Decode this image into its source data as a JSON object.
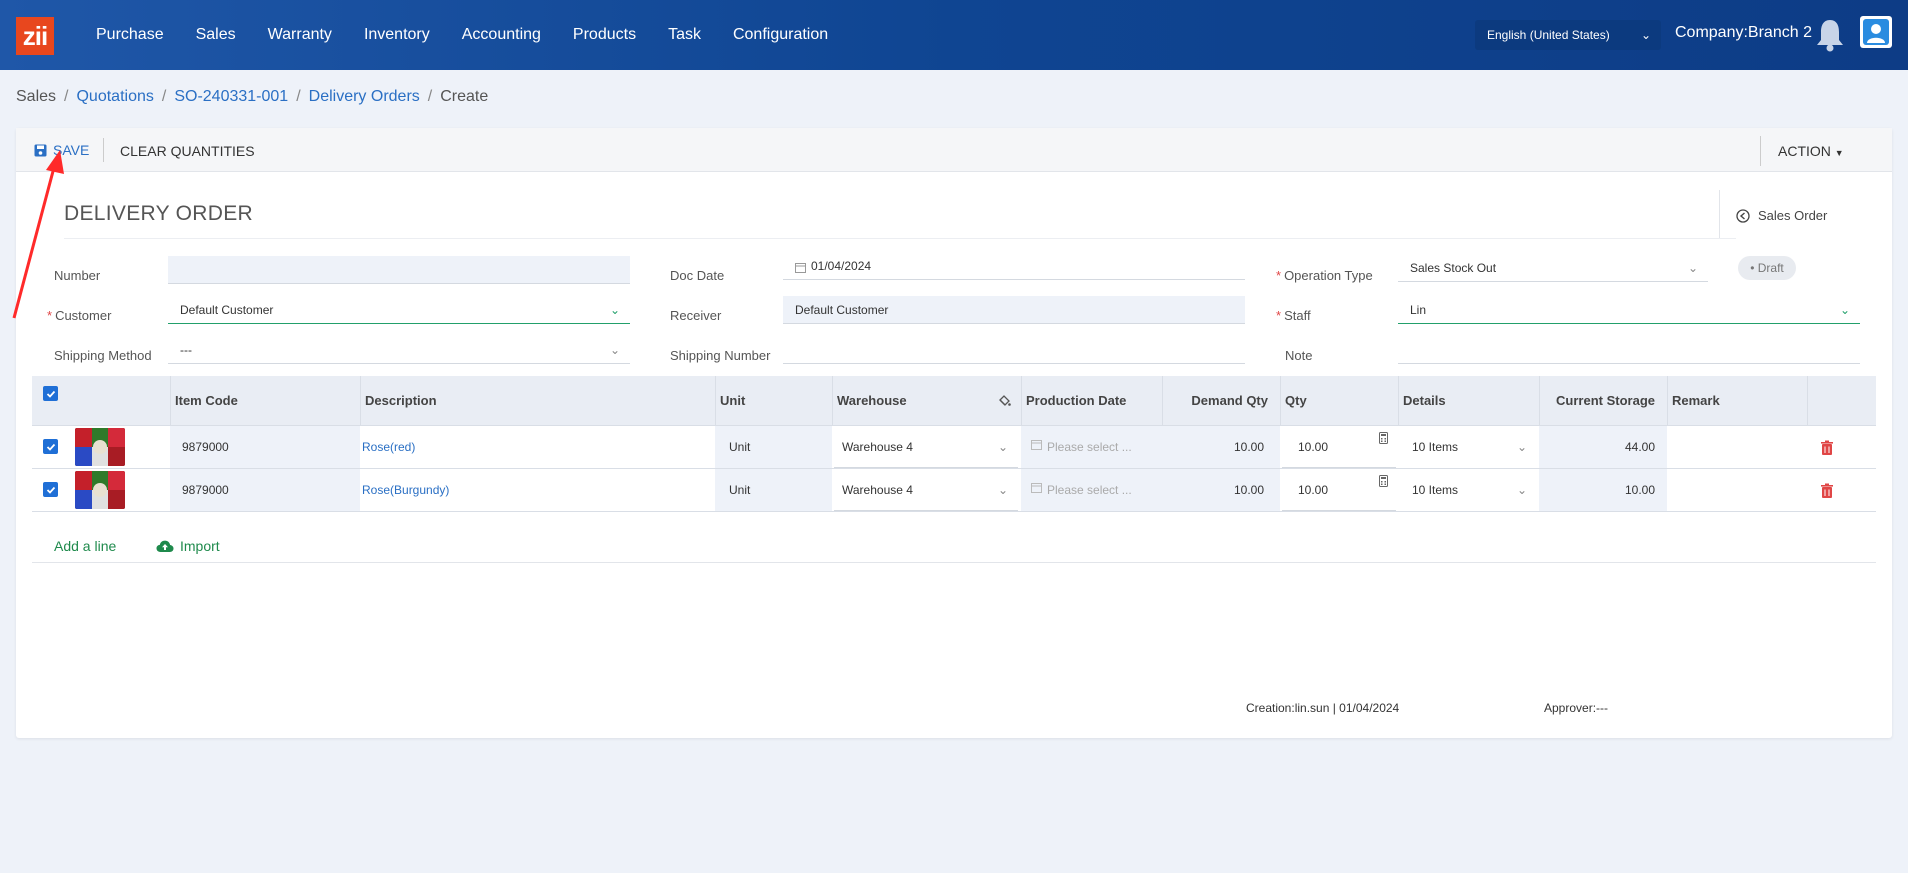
{
  "app": {
    "logo_text": "zii",
    "nav": [
      "Purchase",
      "Sales",
      "Warranty",
      "Inventory",
      "Accounting",
      "Products",
      "Task",
      "Configuration"
    ],
    "language": "English (United States)",
    "company": "Company:Branch 2"
  },
  "breadcrumb": {
    "items": [
      "Sales",
      "Quotations",
      "SO-240331-001",
      "Delivery Orders",
      "Create"
    ],
    "separator": "/"
  },
  "toolbar": {
    "save_label": "SAVE",
    "clear_label": "CLEAR QUANTITIES",
    "action_label": "ACTION"
  },
  "form": {
    "title": "DELIVERY ORDER",
    "sales_order_link": "Sales Order",
    "status": "Draft",
    "labels": {
      "number": "Number",
      "customer": "Customer",
      "shipping_method": "Shipping Method",
      "doc_date": "Doc Date",
      "receiver": "Receiver",
      "shipping_number": "Shipping Number",
      "operation_type": "Operation Type",
      "staff": "Staff",
      "note": "Note"
    },
    "values": {
      "number": "",
      "customer": "Default Customer",
      "shipping_method": "---",
      "doc_date": "01/04/2024",
      "receiver": "Default Customer",
      "shipping_number": "",
      "operation_type": "Sales Stock Out",
      "staff": "Lin",
      "note": ""
    }
  },
  "table": {
    "headers": {
      "item_code": "Item Code",
      "description": "Description",
      "unit": "Unit",
      "warehouse": "Warehouse",
      "production_date": "Production Date",
      "demand_qty": "Demand Qty",
      "qty": "Qty",
      "details": "Details",
      "current_storage": "Current Storage",
      "remark": "Remark"
    },
    "rows": [
      {
        "item_code": "9879000",
        "description": "Rose(red)",
        "unit": "Unit",
        "warehouse": "Warehouse 4",
        "production_date_placeholder": "Please select ...",
        "demand_qty": "10.00",
        "qty": "10.00",
        "details": "10 Items",
        "current_storage": "44.00",
        "remark": ""
      },
      {
        "item_code": "9879000",
        "description": "Rose(Burgundy)",
        "unit": "Unit",
        "warehouse": "Warehouse 4",
        "production_date_placeholder": "Please select ...",
        "demand_qty": "10.00",
        "qty": "10.00",
        "details": "10 Items",
        "current_storage": "10.00",
        "remark": ""
      }
    ],
    "add_line_label": "Add a line",
    "import_label": "Import"
  },
  "footer": {
    "creation": "Creation:lin.sun | 01/04/2024",
    "approver": "Approver:---"
  },
  "colors": {
    "nav_bg": "#0f4592",
    "link": "#2a6fc4",
    "accent_green": "#1f8a4c",
    "logo": "#e8471e",
    "delete": "#e04646",
    "annotation_arrow": "#ff2a2a"
  }
}
